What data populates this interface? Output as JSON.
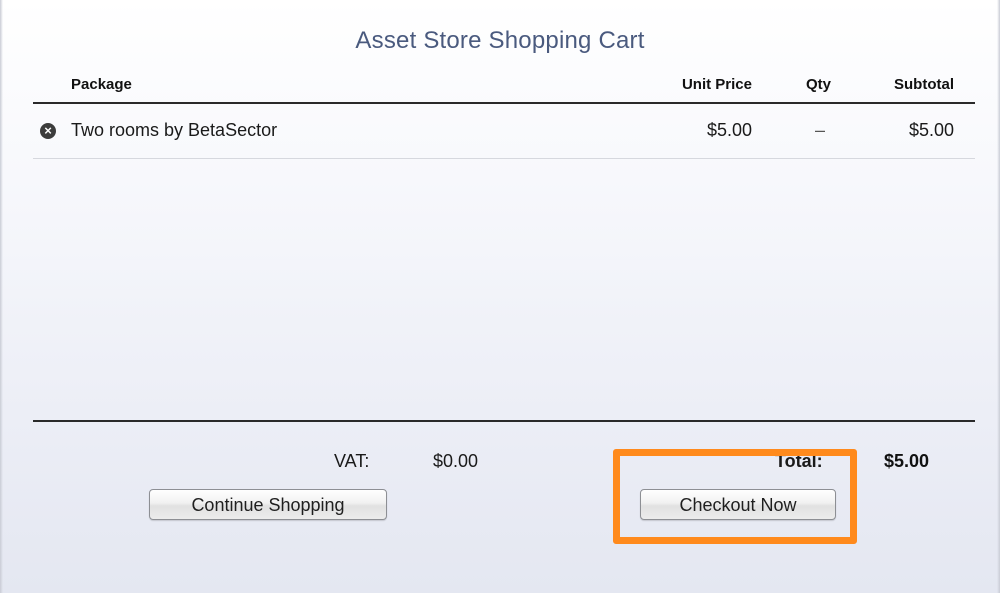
{
  "window": {
    "title": "Asset Store Shopping Cart"
  },
  "table": {
    "columns": [
      "Package",
      "Unit Price",
      "Qty",
      "Subtotal"
    ],
    "rows": [
      {
        "name": "Two rooms by BetaSector",
        "unit_price": "$5.00",
        "qty": "–",
        "subtotal": "$5.00",
        "remove_icon": "remove-circle-icon"
      }
    ]
  },
  "summary": {
    "vat_label": "VAT:",
    "vat_value": "$0.00",
    "total_label": "Total:",
    "total_value": "$5.00"
  },
  "buttons": {
    "continue_label": "Continue Shopping",
    "checkout_label": "Checkout Now"
  },
  "colors": {
    "title": "#4a5a7e",
    "highlight": "#ff8a1c"
  }
}
